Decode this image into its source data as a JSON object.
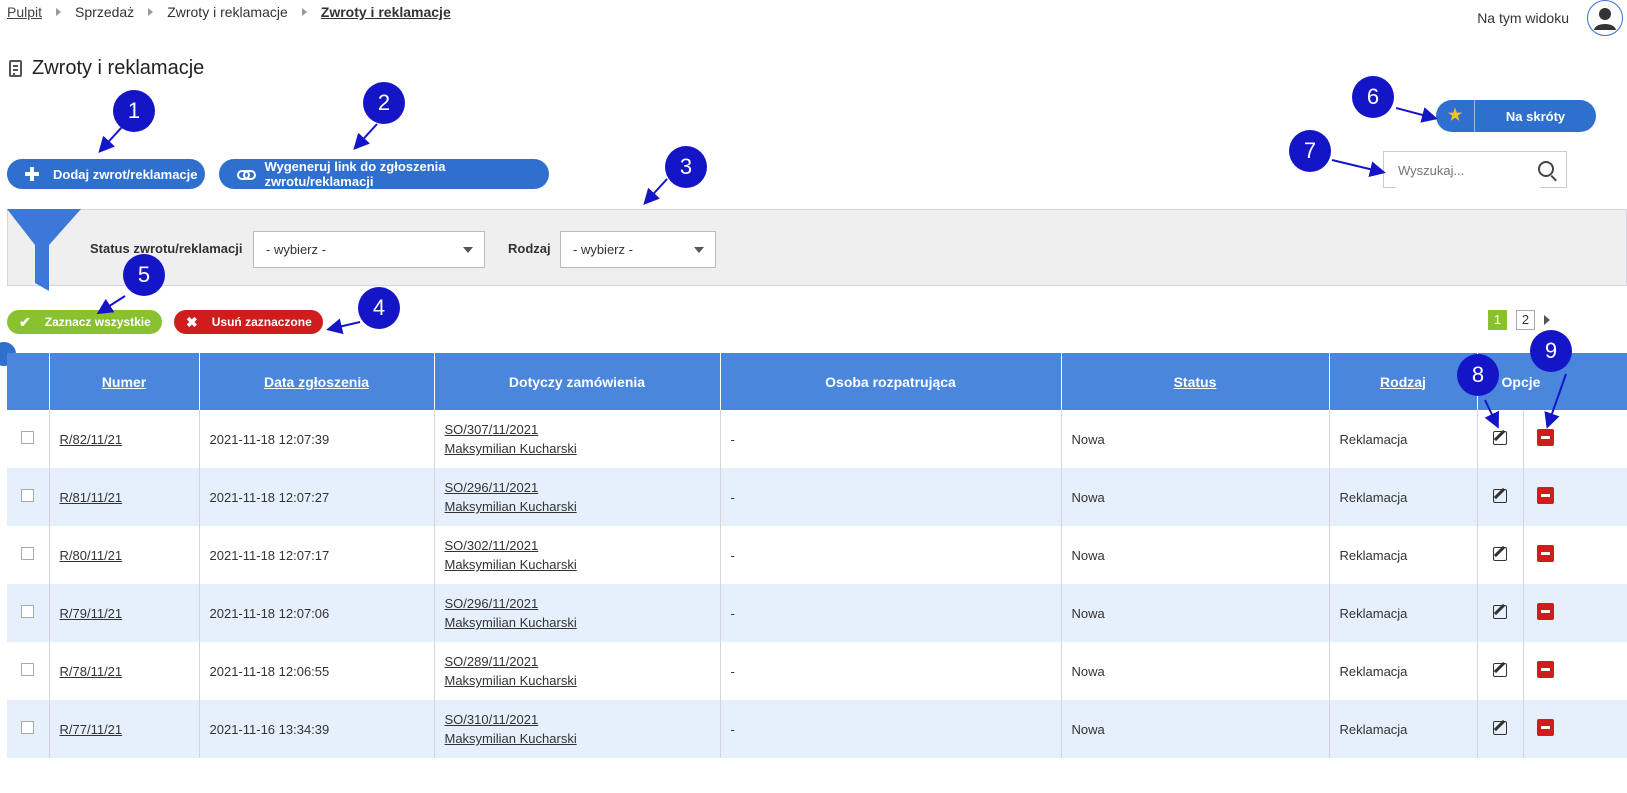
{
  "breadcrumb": {
    "items": [
      "Pulpit",
      "Sprzedaż",
      "Zwroty i reklamacje"
    ],
    "current": "Zwroty i reklamacje"
  },
  "header": {
    "view_label": "Na tym widoku",
    "avatar_icon": "user-icon"
  },
  "page": {
    "title": "Zwroty i reklamacje",
    "title_icon": "document-icon"
  },
  "actions": {
    "add_label": "Dodaj zwrot/reklamacje",
    "link_label": "Wygeneruj link do zgłoszenia zwrotu/reklamacji",
    "shortcut_label": "Na skróty"
  },
  "search": {
    "placeholder": "Wyszukaj..."
  },
  "filters": {
    "status_label": "Status zwrotu/reklamacji",
    "status_value": "- wybierz -",
    "type_label": "Rodzaj",
    "type_value": "- wybierz -"
  },
  "bulk": {
    "select_all": "Zaznacz wszystkie",
    "delete_selected": "Usuń zaznaczone"
  },
  "pager": {
    "current": "1",
    "next_page": "2"
  },
  "table": {
    "headers": {
      "numer": "Numer",
      "data": "Data zgłoszenia",
      "zamowienie": "Dotyczy zamówienia",
      "osoba": "Osoba rozpatrująca",
      "status": "Status",
      "rodzaj": "Rodzaj",
      "opcje": "Opcje"
    },
    "rows": [
      {
        "numer": "R/82/11/21",
        "data": "2021-11-18 12:07:39",
        "order": "SO/307/11/2021",
        "client": "Maksymilian Kucharski",
        "osoba": "-",
        "status": "Nowa",
        "rodzaj": "Reklamacja"
      },
      {
        "numer": "R/81/11/21",
        "data": "2021-11-18 12:07:27",
        "order": "SO/296/11/2021",
        "client": "Maksymilian Kucharski",
        "osoba": "-",
        "status": "Nowa",
        "rodzaj": "Reklamacja"
      },
      {
        "numer": "R/80/11/21",
        "data": "2021-11-18 12:07:17",
        "order": "SO/302/11/2021",
        "client": "Maksymilian Kucharski",
        "osoba": "-",
        "status": "Nowa",
        "rodzaj": "Reklamacja"
      },
      {
        "numer": "R/79/11/21",
        "data": "2021-11-18 12:07:06",
        "order": "SO/296/11/2021",
        "client": "Maksymilian Kucharski",
        "osoba": "-",
        "status": "Nowa",
        "rodzaj": "Reklamacja"
      },
      {
        "numer": "R/78/11/21",
        "data": "2021-11-18 12:06:55",
        "order": "SO/289/11/2021",
        "client": "Maksymilian Kucharski",
        "osoba": "-",
        "status": "Nowa",
        "rodzaj": "Reklamacja"
      },
      {
        "numer": "R/77/11/21",
        "data": "2021-11-16 13:34:39",
        "order": "SO/310/11/2021",
        "client": "Maksymilian Kucharski",
        "osoba": "-",
        "status": "Nowa",
        "rodzaj": "Reklamacja"
      }
    ]
  },
  "annotations": [
    "1",
    "2",
    "3",
    "4",
    "5",
    "6",
    "7",
    "8",
    "9"
  ],
  "colors": {
    "primary": "#2f6fce",
    "header": "#4a86dc",
    "success": "#8ac22f",
    "danger": "#d01c1c",
    "annotation": "#1515c8",
    "row_alt": "#e5f0fc"
  }
}
